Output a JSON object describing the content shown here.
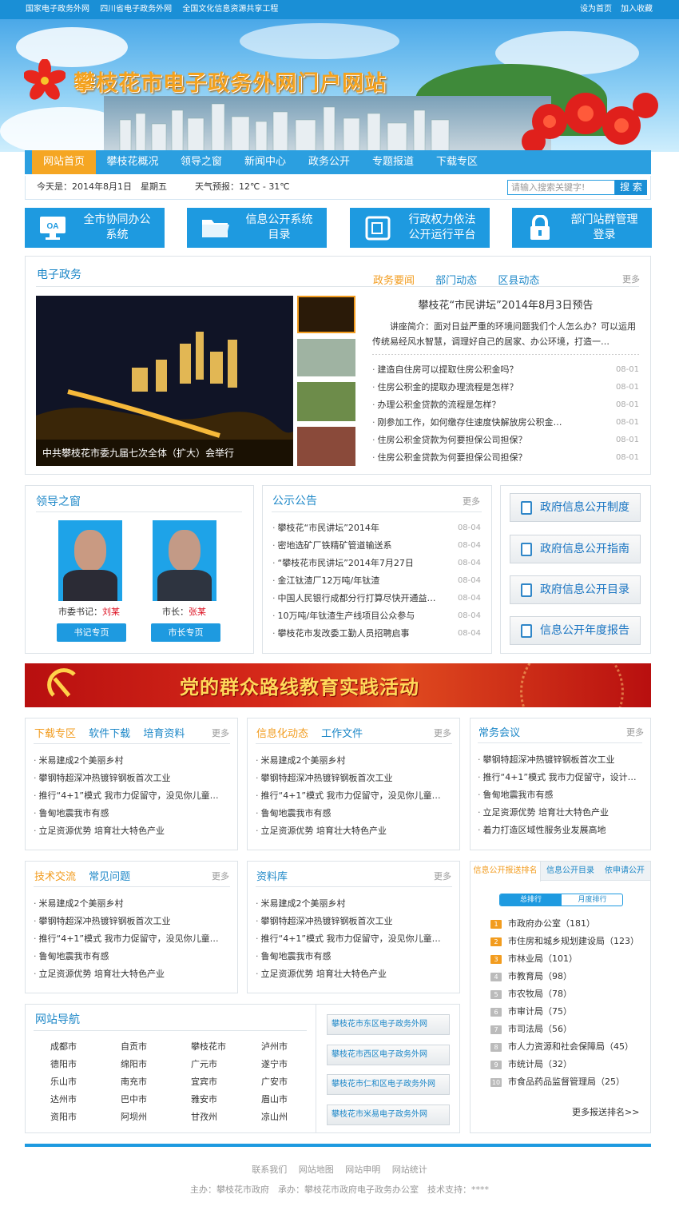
{
  "topbar": {
    "links": [
      "国家电子政务外网",
      "四川省电子政务外网",
      "全国文化信息资源共享工程"
    ],
    "set_home": "设为首页",
    "favorite": "加入收藏"
  },
  "site_title": "攀枝花市电子政务外网门户网站",
  "nav": [
    "网站首页",
    "攀枝花概况",
    "领导之窗",
    "新闻中心",
    "政务公开",
    "专题报道",
    "下载专区"
  ],
  "info": {
    "date": "今天是：2014年8月1日　星期五",
    "weather": "天气预报：12℃ - 31℃",
    "search_placeholder": "请输入搜索关键字!",
    "search_btn": "搜 索"
  },
  "quick": [
    {
      "line1": "全市协同办公",
      "line2": "系统",
      "icon": "oa-monitor-icon",
      "icon_text": "OA"
    },
    {
      "line1": "信息公开系统",
      "line2": "目录",
      "icon": "folder-icon"
    },
    {
      "line1": "行政权力依法",
      "line2": "公开运行平台",
      "icon": "document-icon"
    },
    {
      "line1": "部门站群管理",
      "line2": "登录",
      "icon": "lock-icon"
    }
  ],
  "egov": {
    "title": "电子政务",
    "tabs": [
      "政务要闻",
      "部门动态",
      "区县动态"
    ],
    "more": "更多",
    "photo_caption": "中共攀枝花市委九届七次全体（扩大）会举行",
    "headline": "攀枝花“市民讲坛”2014年8月3日预告",
    "summary": "讲座简介：面对日益严重的环境问题我们个人怎么办？可以运用传统易经风水智慧，调理好自己的居家、办公环境，打造一…",
    "items": [
      {
        "t": "建造自住房可以提取住房公积金吗？",
        "d": "08-01"
      },
      {
        "t": "住房公积金的提取办理流程是怎样？",
        "d": "08-01"
      },
      {
        "t": "办理公积金贷款的流程是怎样？",
        "d": "08-01"
      },
      {
        "t": "刚参加工作，如何缴存住速度快解放房公积金…",
        "d": "08-01"
      },
      {
        "t": "住房公积金贷款为何要担保公司担保？",
        "d": "08-01"
      },
      {
        "t": "住房公积金贷款为何要担保公司担保？",
        "d": "08-01"
      }
    ]
  },
  "leaders": {
    "title": "领导之窗",
    "p1_label": "市委书记：",
    "p1_name": "刘某",
    "p2_label": "市长：",
    "p2_name": "张某",
    "btn1": "书记专页",
    "btn2": "市长专页"
  },
  "notice": {
    "title": "公示公告",
    "more": "更多",
    "items": [
      {
        "t": "攀枝花“市民讲坛”2014年",
        "d": "08-04"
      },
      {
        "t": "密地选矿厂铁精矿管道输送系",
        "d": "08-04"
      },
      {
        "t": "“攀枝花市民讲坛”2014年7月27日",
        "d": "08-04"
      },
      {
        "t": "金江钛渣厂12万吨/年钛渣",
        "d": "08-04"
      },
      {
        "t": "中国人民银行成都分行打算尽快开通益…",
        "d": "08-04"
      },
      {
        "t": "10万吨/年钛渣生产线项目公众参与",
        "d": "08-04"
      },
      {
        "t": "攀枝花市发改委工勤人员招聘启事",
        "d": "08-04"
      }
    ]
  },
  "gov_btns": [
    "政府信息公开制度",
    "政府信息公开指南",
    "政府信息公开目录",
    "信息公开年度报告"
  ],
  "party_banner": "党的群众路线教育实践活动",
  "common_items": [
    "米易建成2个美丽乡村",
    "攀钢特超深冲热镀锌钢板首次工业",
    "推行“4+1”模式 我市力促留守，没见你儿童…",
    "鲁甸地震我市有感",
    "立足资源优势 培育壮大特色产业"
  ],
  "box_download": {
    "tabs": [
      "下载专区",
      "软件下载",
      "培育资料"
    ],
    "more": "更多"
  },
  "box_info": {
    "tabs": [
      "信息化动态",
      "工作文件"
    ],
    "more": "更多"
  },
  "box_meeting": {
    "title": "常务会议",
    "more": "更多",
    "items": [
      "攀钢特超深冲热镀锌钢板首次工业",
      "推行“4+1”模式 我市力促留守，设计…",
      "鲁甸地震我市有感",
      "立足资源优势 培育壮大特色产业",
      "着力打造区域性服务业发展高地"
    ]
  },
  "box_tech": {
    "tabs": [
      "技术交流",
      "常见问题"
    ],
    "more": "更多"
  },
  "box_lib": {
    "title": "资料库",
    "more": "更多"
  },
  "ranking": {
    "tabs": [
      "信息公开报送排名",
      "信息公开目录",
      "依申请公开"
    ],
    "sub": [
      "总排行",
      "月度排行"
    ],
    "items": [
      {
        "n": "1",
        "t": "市政府办公室（181）"
      },
      {
        "n": "2",
        "t": "市住房和城乡规划建设局（123）"
      },
      {
        "n": "3",
        "t": "市林业局（101）"
      },
      {
        "n": "4",
        "t": "市教育局（98）"
      },
      {
        "n": "5",
        "t": "市农牧局（78）"
      },
      {
        "n": "6",
        "t": "市审计局（75）"
      },
      {
        "n": "7",
        "t": "市司法局（56）"
      },
      {
        "n": "8",
        "t": "市人力资源和社会保障局（45）"
      },
      {
        "n": "9",
        "t": "市统计局（32）"
      },
      {
        "n": "10",
        "t": "市食品药品监督管理局（25）"
      }
    ],
    "more": "更多报送排名>>"
  },
  "sitenav": {
    "title": "网站导航",
    "cities": [
      "成都市",
      "自贡市",
      "攀枝花市",
      "泸州市",
      "德阳市",
      "绵阳市",
      "广元市",
      "遂宁市",
      "乐山市",
      "南充市",
      "宜宾市",
      "广安市",
      "达州市",
      "巴中市",
      "雅安市",
      "眉山市",
      "资阳市",
      "阿坝州",
      "甘孜州",
      "凉山州"
    ],
    "links": [
      "攀枝花市东区电子政务外网",
      "攀枝花市西区电子政务外网",
      "攀枝花市仁和区电子政务外网",
      "攀枝花市米易电子政务外网"
    ]
  },
  "footer": {
    "links": [
      "联系我们",
      "网站地图",
      "网站申明",
      "网站统计"
    ],
    "credit": "主办：攀枝花市政府　承办：攀枝花市政府电子政务办公室　技术支持：****"
  }
}
